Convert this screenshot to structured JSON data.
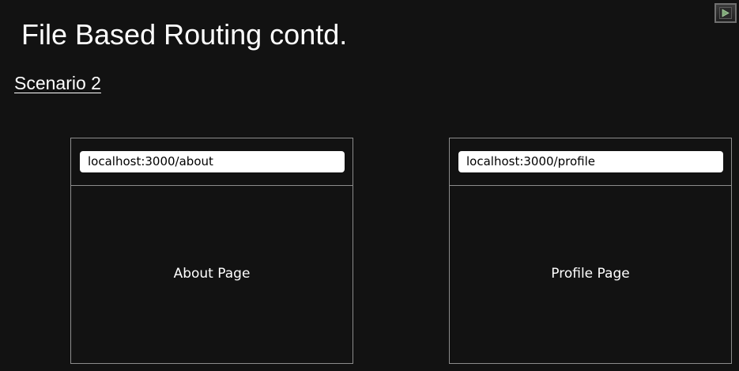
{
  "slide": {
    "title": "File Based Routing contd.",
    "subtitle": "Scenario 2"
  },
  "browsers": [
    {
      "address": "localhost:3000/about",
      "page_label": "About Page"
    },
    {
      "address": "localhost:3000/profile",
      "page_label": "Profile Page"
    }
  ],
  "controls": {
    "play_icon": "play-icon",
    "play_color": "#7fa878"
  }
}
